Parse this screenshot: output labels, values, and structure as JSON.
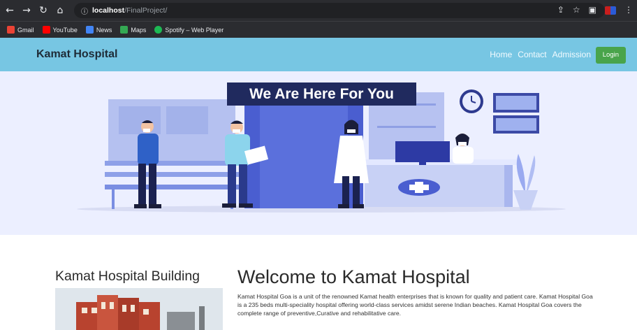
{
  "browser": {
    "url_host": "localhost",
    "url_path": "/FinalProject/",
    "bookmarks": [
      {
        "label": "Gmail",
        "color": "#ea4335"
      },
      {
        "label": "YouTube",
        "color": "#ff0000"
      },
      {
        "label": "News",
        "color": "#4285f4"
      },
      {
        "label": "Maps",
        "color": "#34a853"
      },
      {
        "label": "Spotify – Web Player",
        "color": "#1db954"
      }
    ]
  },
  "navbar": {
    "brand": "Kamat Hospital",
    "links": [
      "Home",
      "Contact",
      "Admission"
    ],
    "login_label": "Login"
  },
  "hero": {
    "title": "We Are Here For You"
  },
  "content": {
    "building_title": "Kamat Hospital Building",
    "welcome_title": "Welcome to Kamat Hospital",
    "about": "Kamat Hospital Goa is a unit of the renowned Kamat health enterprises that is known for quality and patient care. Kamat Hospital Goa is a 235 beds multi-speciality hospital offering world-class services amidst serene Indian beaches. Kamat Hospital Goa covers the complete range of preventive,Curative and rehabilitative care."
  }
}
